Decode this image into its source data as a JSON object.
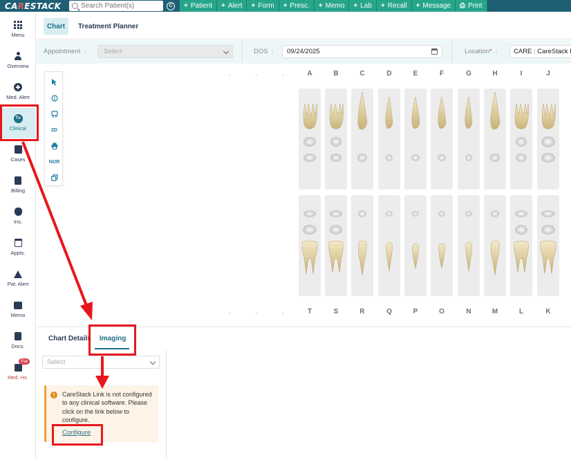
{
  "topbar": {
    "logo": "CARESTACK",
    "search_placeholder": "Search Patient(s)",
    "quick_actions": [
      "Patient",
      "Alert",
      "Form",
      "Presc.",
      "Memo",
      "Lab",
      "Recall",
      "Message"
    ],
    "print_label": "Print"
  },
  "leftnav": {
    "items": [
      {
        "label": "Menu",
        "icon": "grid-icon"
      },
      {
        "label": "Overview",
        "icon": "person-icon"
      },
      {
        "label": "Med. Alert",
        "icon": "plus-circle-icon"
      },
      {
        "label": "Clinical",
        "icon": "clinical-icon",
        "active": true
      },
      {
        "label": "Cases",
        "icon": "clipboard-icon"
      },
      {
        "label": "Billing",
        "icon": "billing-icon"
      },
      {
        "label": "Ins.",
        "icon": "shield-icon"
      },
      {
        "label": "Appts.",
        "icon": "calendar-icon"
      },
      {
        "label": "Pat. Alert",
        "icon": "alert-triangle-icon"
      },
      {
        "label": "Memo",
        "icon": "memo-icon"
      },
      {
        "label": "Docs.",
        "icon": "docs-icon"
      },
      {
        "label": "Med. Hx.",
        "icon": "medical-history-icon"
      }
    ],
    "medhx_badge": "Pat"
  },
  "tabs": {
    "chart": "Chart",
    "treatment_planner": "Treatment Planner"
  },
  "filters": {
    "appointment_label": "Appointment",
    "appointment_placeholder": "Select",
    "dos_label": "DOS",
    "dos_value": "09/24/2025",
    "location_label": "Location",
    "location_value": "CARE : CareStack Dental"
  },
  "palette": {
    "items": [
      "select-icon",
      "info-icon",
      "tooth-icon",
      "2D",
      "print-icon",
      "NOR",
      "copy-icon"
    ],
    "label_2d": "2D",
    "label_nor": "NOR"
  },
  "teeth": {
    "upper_labels": [
      "A",
      "B",
      "C",
      "D",
      "E",
      "F",
      "G",
      "H",
      "I",
      "J"
    ],
    "lower_labels": [
      "T",
      "S",
      "R",
      "Q",
      "P",
      "O",
      "N",
      "M",
      "L",
      "K"
    ],
    "placeholder": "."
  },
  "bottom": {
    "tab_chart_details": "Chart Details",
    "tab_imaging": "Imaging",
    "imaging_select_placeholder": "Select",
    "warning_text": "CareStack Link is not configured to any clinical software. Please click on the link below to configure.",
    "configure_link": "Configure"
  },
  "colors": {
    "topbar": "#1e5f74",
    "accent": "#1e6f86",
    "quick_action": "#27a58a",
    "annotation": "#e8161c",
    "warning_bg": "#fdf3e6"
  }
}
